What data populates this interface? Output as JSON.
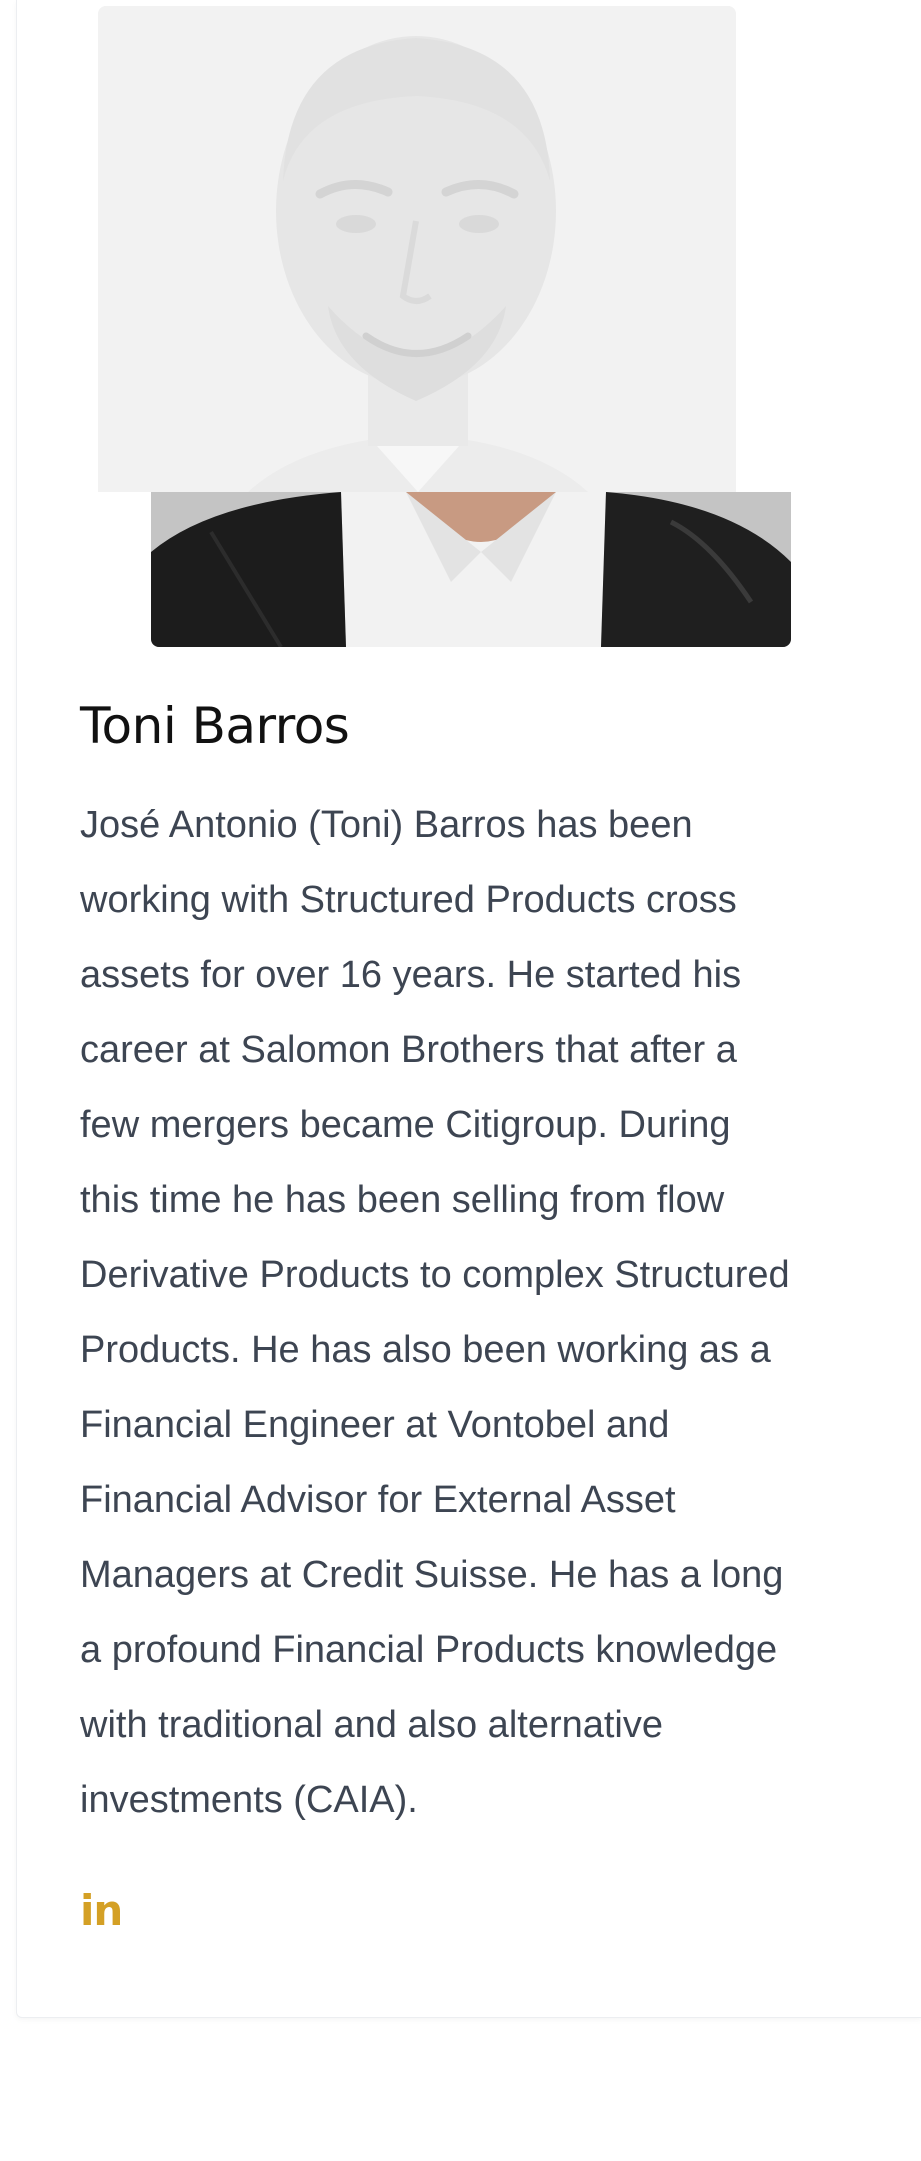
{
  "profile": {
    "photo_alt": "Toni Barros portrait",
    "name": "Toni Barros",
    "bio_lines": [
      "José Antonio (Toni) Barros has been",
      "working with Structured Products cross",
      "assets for over 16 years. He started his",
      "career at Salomon Brothers that after a",
      "few mergers became Citigroup. During",
      "this time he has been selling from flow",
      "Derivative Products to complex Structured",
      "Products. He has also been working as a",
      "Financial Engineer at Vontobel and",
      "Financial Advisor for External Asset",
      "Managers at Credit Suisse. He has a long",
      "a profound Financial Products knowledge",
      "with traditional and also alternative",
      "investments (CAIA)."
    ],
    "social": {
      "linkedin_label": "in",
      "linkedin_icon": "linkedin-icon"
    }
  },
  "colors": {
    "accent": "#d4a025",
    "name_text": "#111111",
    "body_text": "#3d4552"
  }
}
